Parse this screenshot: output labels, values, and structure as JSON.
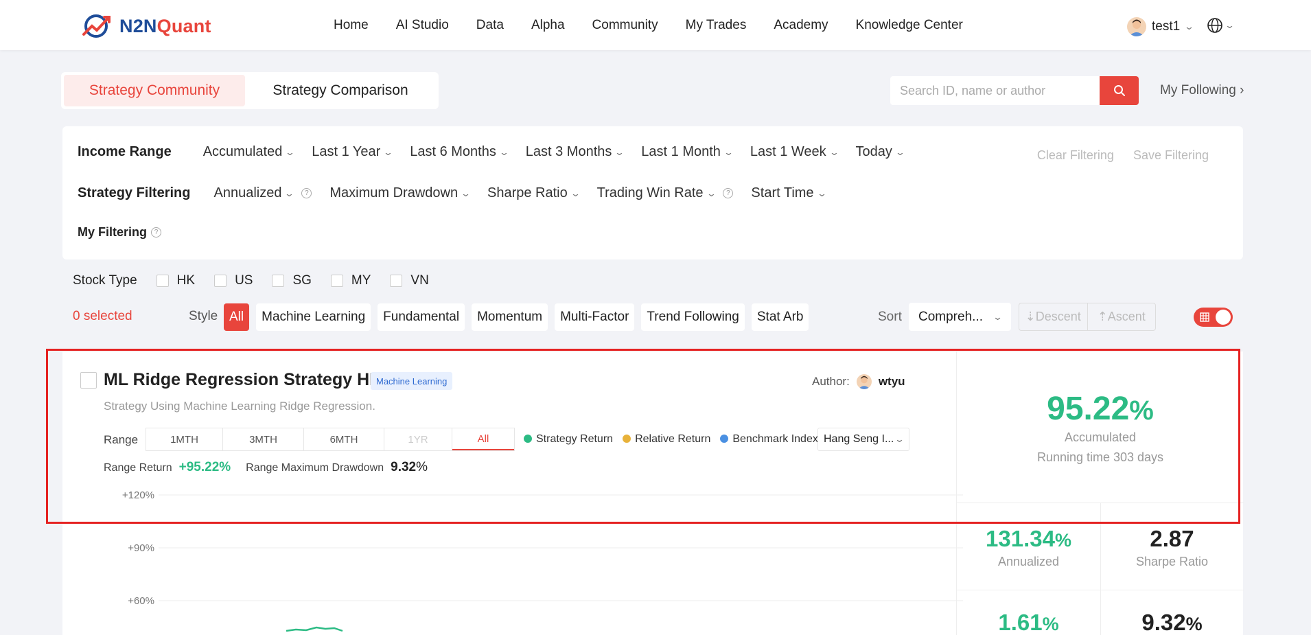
{
  "brand": {
    "part1": "N2N",
    "part2": "Quant"
  },
  "nav": [
    "Home",
    "AI Studio",
    "Data",
    "Alpha",
    "Community",
    "My Trades",
    "Academy",
    "Knowledge Center"
  ],
  "user": {
    "name": "test1"
  },
  "tabs": {
    "active": "Strategy Community",
    "inactive": "Strategy Comparison"
  },
  "search": {
    "placeholder": "Search ID, name or author"
  },
  "following": "My Following",
  "filters": {
    "income_label": "Income Range",
    "income_options": [
      "Accumulated",
      "Last 1 Year",
      "Last 6 Months",
      "Last 3 Months",
      "Last 1 Month",
      "Last 1 Week",
      "Today"
    ],
    "strategy_label": "Strategy Filtering",
    "strategy_options": [
      "Annualized",
      "Maximum Drawdown",
      "Sharpe Ratio",
      "Trading Win Rate",
      "Start Time"
    ],
    "my_label": "My Filtering",
    "clear": "Clear Filtering",
    "save": "Save Filtering"
  },
  "stock": {
    "label": "Stock Type",
    "options": [
      "HK",
      "US",
      "SG",
      "MY",
      "VN"
    ]
  },
  "selected": "0 selected",
  "style": {
    "label": "Style",
    "chips": [
      "All",
      "Machine Learning",
      "Fundamental",
      "Momentum",
      "Multi-Factor",
      "Trend Following",
      "Stat Arb"
    ]
  },
  "sort": {
    "label": "Sort",
    "value": "Compreh...",
    "descent": "Descent",
    "ascent": "Ascent"
  },
  "card": {
    "title": "ML Ridge Regression Strategy HK",
    "tag": "Machine Learning",
    "author_label": "Author:",
    "author": "wtyu",
    "desc": "Strategy Using Machine Learning Ridge Regression.",
    "range_label": "Range",
    "ranges": [
      "1MTH",
      "3MTH",
      "6MTH",
      "1YR",
      "All"
    ],
    "legend": [
      "Strategy Return",
      "Relative Return",
      "Benchmark Index"
    ],
    "legend_colors": [
      "#2cbb84",
      "#e8b23a",
      "#4a90e2"
    ],
    "benchmark": "Hang Seng I...",
    "range_return_label": "Range Return",
    "range_return": "+95.22%",
    "range_dd_label": "Range Maximum Drawdown",
    "range_dd": "9.32",
    "range_dd_unit": "%",
    "accumulated": "95.22",
    "accumulated_unit": "%",
    "accumulated_label": "Accumulated",
    "running": "Running time 303 days",
    "annualized": "131.34",
    "annualized_label": "Annualized",
    "sharpe": "2.87",
    "sharpe_label": "Sharpe Ratio",
    "stat3": "1.61",
    "stat4": "9.32",
    "pct": "%"
  },
  "chart_data": {
    "type": "line",
    "y_ticks": [
      "+120%",
      "+90%",
      "+60%"
    ],
    "series": [
      {
        "name": "Strategy Return",
        "color": "#2cbb84"
      }
    ]
  }
}
